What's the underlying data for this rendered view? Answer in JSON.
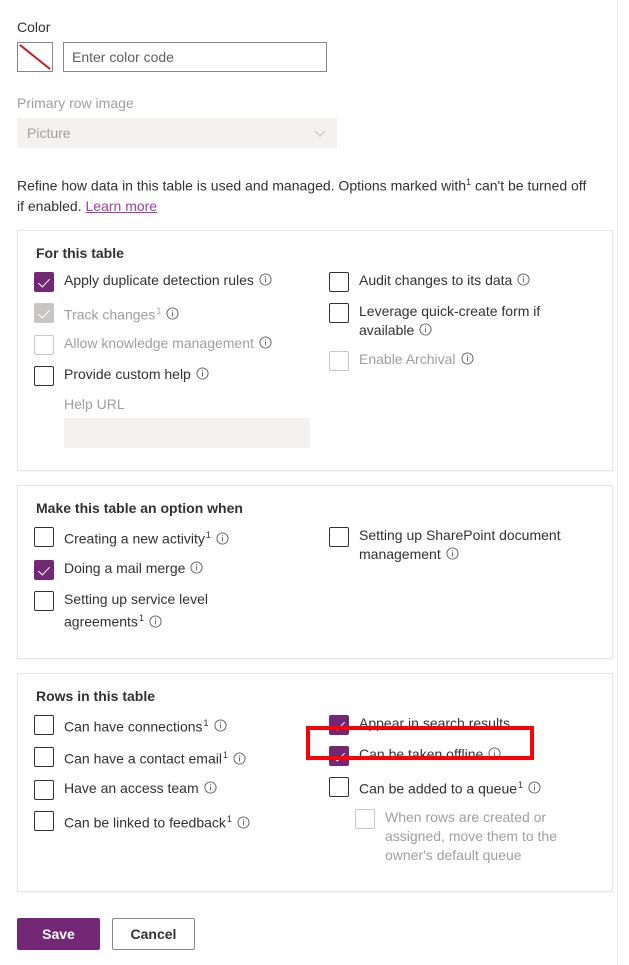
{
  "colors": {
    "accent": "#742774",
    "link": "#a23fa2",
    "highlight": "#fb0007",
    "disabled_text": "#a19f9d"
  },
  "color_field": {
    "label": "Color",
    "swatch_name": "no-color",
    "input_placeholder": "Enter color code",
    "input_value": ""
  },
  "primary_row_image": {
    "label": "Primary row image",
    "selected": "Picture",
    "disabled": true
  },
  "intro": {
    "text_before": "Refine how data in this table is used and managed. Options marked with",
    "marker": "1",
    "text_after": "can't be turned off if enabled.",
    "link": "Learn more"
  },
  "cards": [
    {
      "title": "For this table",
      "left": [
        {
          "label": "Apply duplicate detection rules",
          "checked": true,
          "disabled": false,
          "marker": false,
          "info": true
        },
        {
          "label": "Track changes",
          "checked": true,
          "disabled": true,
          "marker": true,
          "info": true
        },
        {
          "label": "Allow knowledge management",
          "checked": false,
          "disabled": true,
          "marker": false,
          "info": true
        },
        {
          "label": "Provide custom help",
          "checked": false,
          "disabled": false,
          "marker": false,
          "info": true
        }
      ],
      "sub_field": {
        "label": "Help URL",
        "value": "",
        "disabled": true
      },
      "right": [
        {
          "label": "Audit changes to its data",
          "checked": false,
          "disabled": false,
          "marker": false,
          "info": true
        },
        {
          "label": "Leverage quick-create form if available",
          "checked": false,
          "disabled": false,
          "marker": false,
          "info": true
        },
        {
          "label": "Enable Archival",
          "checked": false,
          "disabled": true,
          "marker": false,
          "info": true
        }
      ]
    },
    {
      "title": "Make this table an option when",
      "left": [
        {
          "label": "Creating a new activity",
          "checked": false,
          "disabled": false,
          "marker": true,
          "info": true
        },
        {
          "label": "Doing a mail merge",
          "checked": true,
          "disabled": false,
          "marker": false,
          "info": true
        },
        {
          "label": "Setting up service level agreements",
          "checked": false,
          "disabled": false,
          "marker": true,
          "info": true
        }
      ],
      "right": [
        {
          "label": "Setting up SharePoint document management",
          "checked": false,
          "disabled": false,
          "marker": false,
          "info": true
        }
      ]
    },
    {
      "title": "Rows in this table",
      "left": [
        {
          "label": "Can have connections",
          "checked": false,
          "disabled": false,
          "marker": true,
          "info": true
        },
        {
          "label": "Can have a contact email",
          "checked": false,
          "disabled": false,
          "marker": true,
          "info": true
        },
        {
          "label": "Have an access team",
          "checked": false,
          "disabled": false,
          "marker": false,
          "info": true
        },
        {
          "label": "Can be linked to feedback",
          "checked": false,
          "disabled": false,
          "marker": true,
          "info": true
        }
      ],
      "right": [
        {
          "label": "Appear in search results",
          "checked": true,
          "disabled": false,
          "marker": false,
          "info": false
        },
        {
          "label": "Can be taken offline",
          "checked": true,
          "disabled": false,
          "marker": false,
          "info": true,
          "highlighted": true
        },
        {
          "label": "Can be added to a queue",
          "checked": false,
          "disabled": false,
          "marker": true,
          "info": true
        },
        {
          "label": "When rows are created or assigned, move them to the owner's default queue",
          "checked": false,
          "disabled": true,
          "marker": false,
          "info": false,
          "indent": true
        }
      ]
    }
  ],
  "footer": {
    "save_label": "Save",
    "cancel_label": "Cancel"
  }
}
